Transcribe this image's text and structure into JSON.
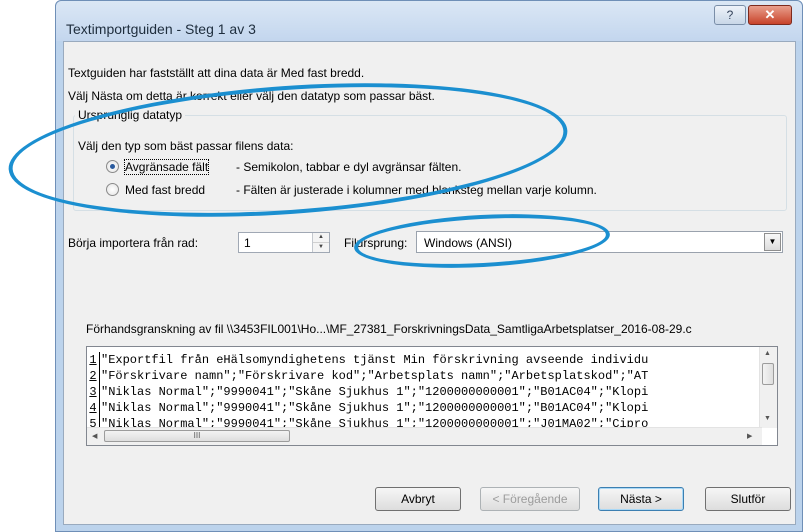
{
  "window": {
    "title": "Textimportguiden - Steg 1 av 3",
    "help_label": "?",
    "close_label": "✕"
  },
  "intro": {
    "line1": "Textguiden har fastställt att dina data är Med fast bredd.",
    "line2": "Välj Nästa om detta är korrekt eller välj den datatyp som passar bäst."
  },
  "datatype": {
    "group_title": "Ursprunglig datatyp",
    "prompt": "Välj den typ som bäst passar filens data:",
    "options": [
      {
        "label": "Avgränsade fält",
        "description": "- Semikolon, tabbar e dyl avgränsar fälten.",
        "selected": true
      },
      {
        "label": "Med fast bredd",
        "description": "- Fälten är justerade i kolumner med blanksteg mellan varje kolumn.",
        "selected": false
      }
    ]
  },
  "start_row": {
    "label": "Börja importera från rad:",
    "value": "1"
  },
  "origin": {
    "label": "Filursprung:",
    "value": "Windows (ANSI)"
  },
  "preview": {
    "label": "Förhandsgranskning av fil \\\\3453FIL001\\Ho...\\MF_27381_ForskrivningsData_SamtligaArbetsplatser_2016-08-29.c",
    "rows": [
      {
        "num": "1",
        "text": "\"Exportfil från eHälsomyndighetens tjänst Min förskrivning avseende individu"
      },
      {
        "num": "2",
        "text": "\"Förskrivare namn\";\"Förskrivare kod\";\"Arbetsplats namn\";\"Arbetsplatskod\";\"AT"
      },
      {
        "num": "3",
        "text": "\"Niklas Normal\";\"9990041\";\"Skåne Sjukhus 1\";\"1200000000001\";\"B01AC04\";\"Klopi"
      },
      {
        "num": "4",
        "text": "\"Niklas Normal\";\"9990041\";\"Skåne Sjukhus 1\";\"1200000000001\";\"B01AC04\";\"Klopi"
      },
      {
        "num": "5",
        "text": "\"Niklas Normal\";\"9990041\";\"Skåne Sjukhus 1\";\"1200000000001\";\"J01MA02\";\"Cipro"
      }
    ],
    "hthumb_grip": "III"
  },
  "buttons": {
    "cancel": "Avbryt",
    "back": "< Föregående",
    "next": "Nästa >",
    "finish": "Slutför"
  },
  "colors": {
    "annotation": "#1b8fd0",
    "title_bar": "#c3d6ee",
    "close_button": "#c8432a"
  }
}
